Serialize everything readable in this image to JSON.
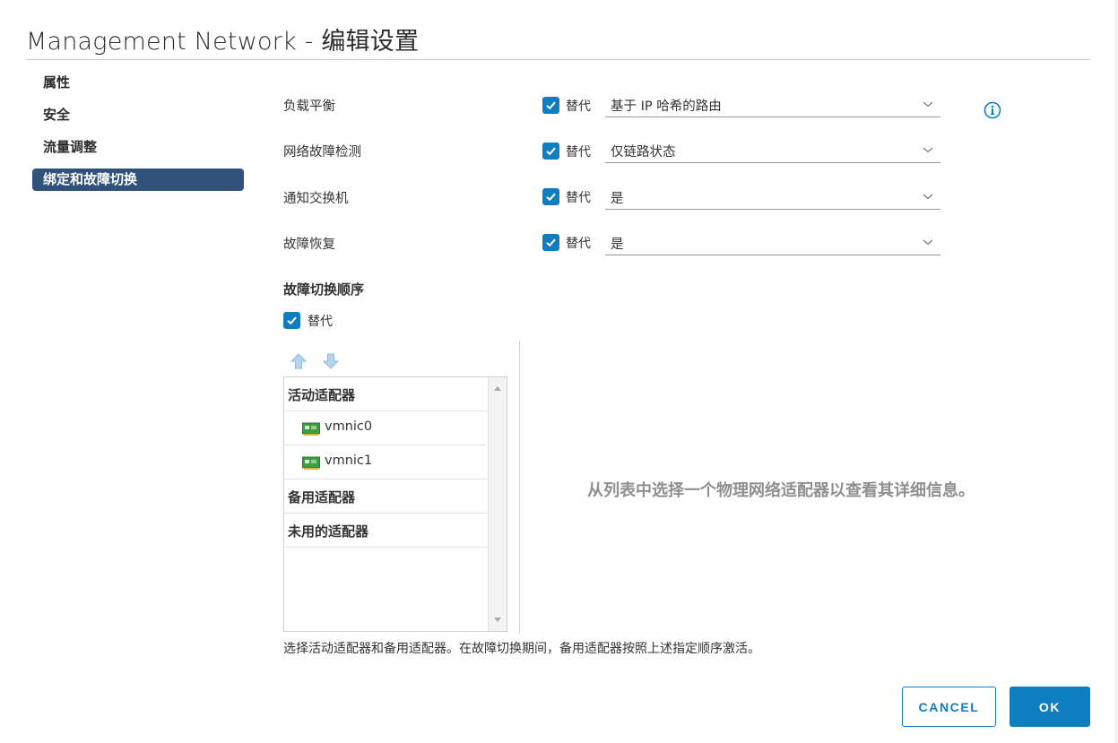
{
  "dialog": {
    "title": "Management Network - 编辑设置"
  },
  "sidebar": {
    "items": [
      {
        "label": "属性",
        "active": false
      },
      {
        "label": "安全",
        "active": false
      },
      {
        "label": "流量调整",
        "active": false
      },
      {
        "label": "绑定和故障切换",
        "active": true
      }
    ]
  },
  "settings": {
    "rows": [
      {
        "label": "负载平衡",
        "override_checked": true,
        "override_label": "替代",
        "value": "基于 IP 哈希的路由"
      },
      {
        "label": "网络故障检测",
        "override_checked": true,
        "override_label": "替代",
        "value": "仅链路状态"
      },
      {
        "label": "通知交换机",
        "override_checked": true,
        "override_label": "替代",
        "value": "是"
      },
      {
        "label": "故障恢复",
        "override_checked": true,
        "override_label": "替代",
        "value": "是"
      }
    ],
    "info_icon": "info-circle-icon"
  },
  "failover": {
    "title": "故障切换顺序",
    "override_checked": true,
    "override_label": "替代",
    "move_up_icon": "arrow-up-icon",
    "move_down_icon": "arrow-down-icon",
    "list": [
      {
        "type": "group",
        "label": "活动适配器"
      },
      {
        "type": "nic",
        "label": "vmnic0",
        "icon": "network-card-icon"
      },
      {
        "type": "nic",
        "label": "vmnic1",
        "icon": "network-card-icon"
      },
      {
        "type": "group",
        "label": "备用适配器"
      },
      {
        "type": "group",
        "label": "未用的适配器"
      }
    ],
    "empty_detail": "从列表中选择一个物理网络适配器以查看其详细信息。",
    "hint": "选择活动适配器和备用适配器。在故障切换期间，备用适配器按照上述指定顺序激活。"
  },
  "footer": {
    "cancel_label": "CANCEL",
    "ok_label": "OK"
  },
  "colors": {
    "accent": "#0f7ec1",
    "sidebar_active": "#31527a",
    "nic_icon": "#3f9d3f"
  }
}
